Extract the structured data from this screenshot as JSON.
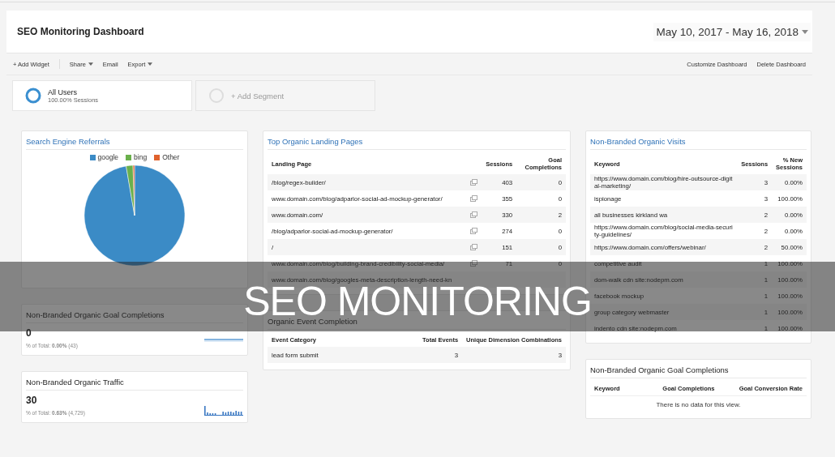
{
  "header": {
    "title": "SEO Monitoring Dashboard",
    "date_range": "May 10, 2017 - May 16, 2018"
  },
  "toolbar": {
    "left": [
      {
        "label": "+ Add Widget",
        "dropdown": false
      },
      {
        "label": "Share",
        "dropdown": true
      },
      {
        "label": "Email",
        "dropdown": false
      },
      {
        "label": "Export",
        "dropdown": true
      }
    ],
    "right": [
      {
        "label": "Customize Dashboard",
        "dropdown": false
      },
      {
        "label": "Delete Dashboard",
        "dropdown": false
      }
    ]
  },
  "segments": [
    {
      "kind": "segment",
      "name": "All Users",
      "detail": "100.00% Sessions"
    },
    {
      "kind": "add",
      "name": "+ Add Segment"
    }
  ],
  "columns": [
    {
      "widgets": [
        {
          "kind": "pie",
          "title": "Search Engine Referrals",
          "title_link": true,
          "chart_data": {
            "type": "pie",
            "categories": [
              "google",
              "bing",
              "Other"
            ],
            "values": [
              97.3,
              2.2,
              0.5
            ],
            "colors": [
              "#3b8bc6",
              "#6ab04c",
              "#e0622d"
            ]
          }
        },
        {
          "kind": "metric",
          "title": "Non-Branded Organic Goal Completions",
          "title_link": false,
          "value": "0",
          "total": "% of Total: **0.00%** (43)"
        },
        {
          "kind": "metric",
          "title": "Non-Branded Organic Traffic",
          "title_link": false,
          "value": "30",
          "total": "% of Total: **0.63%** (4,729)"
        }
      ]
    },
    {
      "widgets": [
        {
          "kind": "table",
          "title": "Top Organic Landing Pages",
          "title_link": true,
          "row_icons": true,
          "columns": [
            "Landing Page",
            "Sessions",
            "Goal Completions"
          ],
          "rows": [
            [
              "/blog/regex-builder/",
              "403",
              "0"
            ],
            [
              "www.domain.com/blog/adparlor-social-ad-mockup-generator/",
              "355",
              "0"
            ],
            [
              "www.domain.com/",
              "330",
              "2"
            ],
            [
              "/blog/adparlor-social-ad-mockup-generator/",
              "274",
              "0"
            ],
            [
              "/",
              "151",
              "0"
            ],
            [
              "www.domain.com/blog/building-brand-credibility-social-media/",
              "71",
              "0"
            ],
            [
              "www.domain.com/blog/googles-meta-description-length-need-kn"
            ]
          ]
        },
        {
          "kind": "table",
          "title": "Organic Event Completion",
          "title_link": false,
          "row_icons": false,
          "columns": [
            "Event Category",
            "Total Events",
            "Unique Dimension Combinations"
          ],
          "rows": [
            [
              "lead form submit",
              "3",
              "3"
            ]
          ]
        }
      ]
    },
    {
      "widgets": [
        {
          "kind": "table",
          "title": "Non-Branded Organic Visits",
          "title_link": true,
          "row_icons": false,
          "columns": [
            "Keyword",
            "Sessions",
            "% New Sessions"
          ],
          "rows": [
            [
              "https://www.domain.com/blog/hire-outsource-digital-marketing/",
              "3",
              "0.00%"
            ],
            [
              "ispionage",
              "3",
              "100.00%"
            ],
            [
              "all businesses kirkland wa",
              "2",
              "0.00%"
            ],
            [
              "https://www.domain.com/blog/social-media-security-guidelines/",
              "2",
              "0.00%"
            ],
            [
              "https://www.domain.com/offers/webinar/",
              "2",
              "50.00%"
            ],
            [
              "competitive audit",
              "1",
              "100.00%"
            ],
            [
              "dom-walk cdn site:nodepm.com",
              "1",
              "100.00%"
            ],
            [
              "facebook mockup",
              "1",
              "100.00%"
            ],
            [
              "group category webmaster",
              "1",
              "100.00%"
            ],
            [
              "indento cdn site:nodepm.com",
              "1",
              "100.00%"
            ]
          ]
        },
        {
          "kind": "table",
          "title": "Non-Branded Organic Goal Completions",
          "title_link": false,
          "row_icons": false,
          "columns": [
            "Keyword",
            "Goal Completions",
            "Goal Conversion Rate"
          ],
          "empty_message": "There is no data for this view."
        }
      ]
    }
  ],
  "banner": {
    "text": "SEO MONITORING"
  }
}
